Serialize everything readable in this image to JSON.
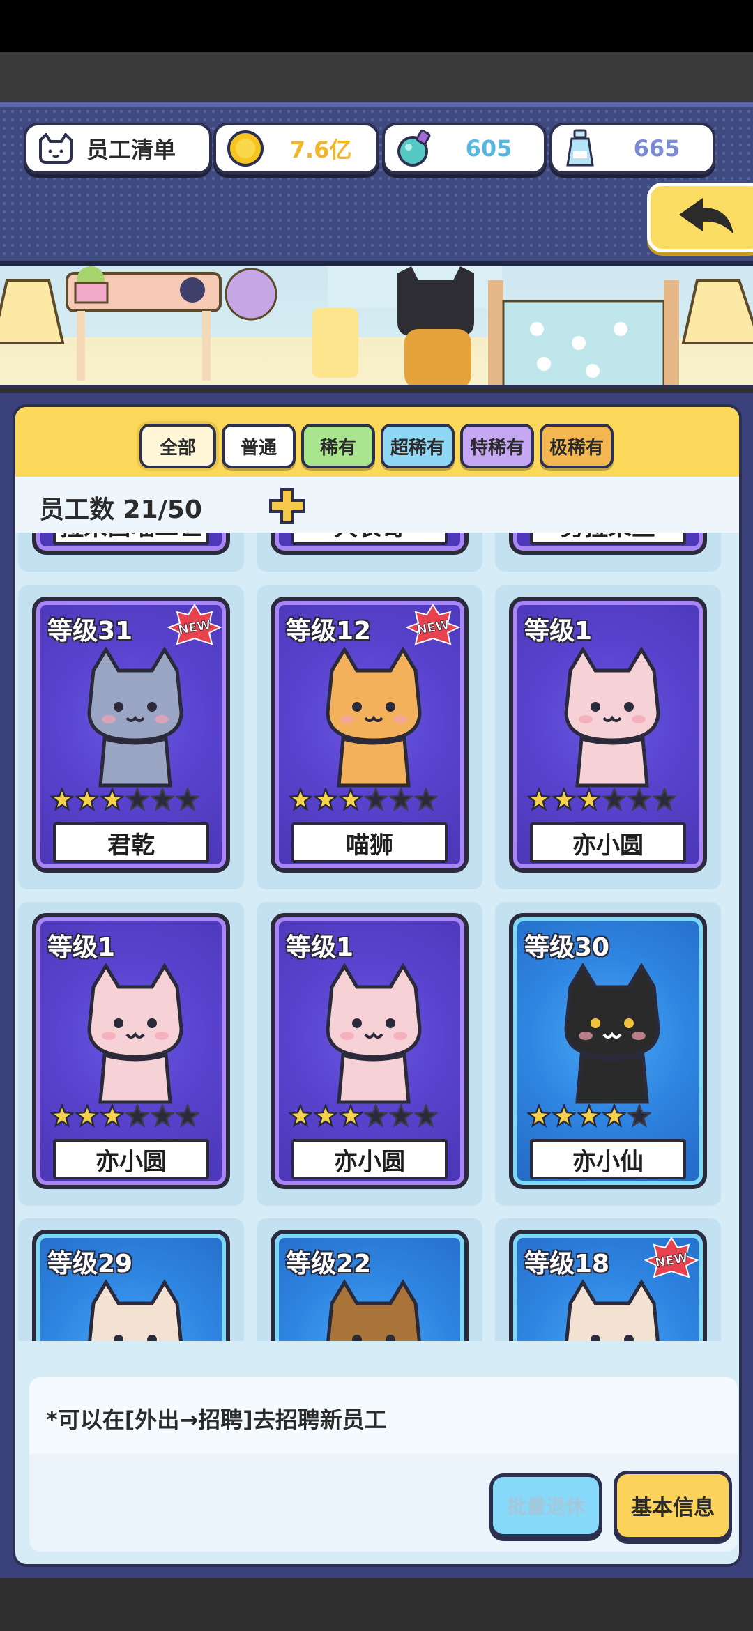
{
  "header": {
    "title": "员工清单",
    "coins": "7.6亿",
    "potion": "605",
    "bottle": "665"
  },
  "tabs": [
    {
      "label": "全部",
      "class": "all"
    },
    {
      "label": "普通",
      "class": "normal"
    },
    {
      "label": "稀有",
      "class": "rare"
    },
    {
      "label": "超稀有",
      "class": "srare"
    },
    {
      "label": "特稀有",
      "class": "trare"
    },
    {
      "label": "极稀有",
      "class": "urare"
    }
  ],
  "employee_count": "员工数 21/50",
  "partial_row": [
    "拉米西喵二世",
    "大表哥",
    "劳拉朵兰"
  ],
  "cards": [
    {
      "level": "等级31",
      "name": "君乾",
      "new": true,
      "stars": 3,
      "max_stars": 6,
      "color": "purple",
      "fur": "#9aa6c4"
    },
    {
      "level": "等级12",
      "name": "喵狮",
      "new": true,
      "stars": 3,
      "max_stars": 6,
      "color": "purple",
      "fur": "#f2b15a"
    },
    {
      "level": "等级1",
      "name": "亦小圆",
      "new": false,
      "stars": 3,
      "max_stars": 6,
      "color": "purple",
      "fur": "#f6d2d6"
    },
    {
      "level": "等级1",
      "name": "亦小圆",
      "new": false,
      "stars": 3,
      "max_stars": 6,
      "color": "purple",
      "fur": "#f6d2d6"
    },
    {
      "level": "等级1",
      "name": "亦小圆",
      "new": false,
      "stars": 3,
      "max_stars": 6,
      "color": "purple",
      "fur": "#f6d2d6"
    },
    {
      "level": "等级30",
      "name": "亦小仙",
      "new": false,
      "stars": 4,
      "max_stars": 5,
      "color": "blue",
      "fur": "#2a2a2a"
    },
    {
      "level": "等级29",
      "name": "",
      "new": false,
      "stars": 0,
      "max_stars": 0,
      "color": "blue",
      "fur": "#f3e1d2"
    },
    {
      "level": "等级22",
      "name": "",
      "new": false,
      "stars": 0,
      "max_stars": 0,
      "color": "blue",
      "fur": "#a9743a"
    },
    {
      "level": "等级18",
      "name": "",
      "new": true,
      "stars": 0,
      "max_stars": 0,
      "color": "blue",
      "fur": "#f3e1d2"
    }
  ],
  "new_badge": "NEW",
  "hint": "*可以在[外出→招聘]去招聘新员工",
  "buttons": {
    "retire": "批量退休",
    "info": "基本信息"
  },
  "colors": {
    "accent_yellow": "#fcd85a",
    "panel": "#d6ecf7",
    "header_bg": "#3f4a80"
  }
}
